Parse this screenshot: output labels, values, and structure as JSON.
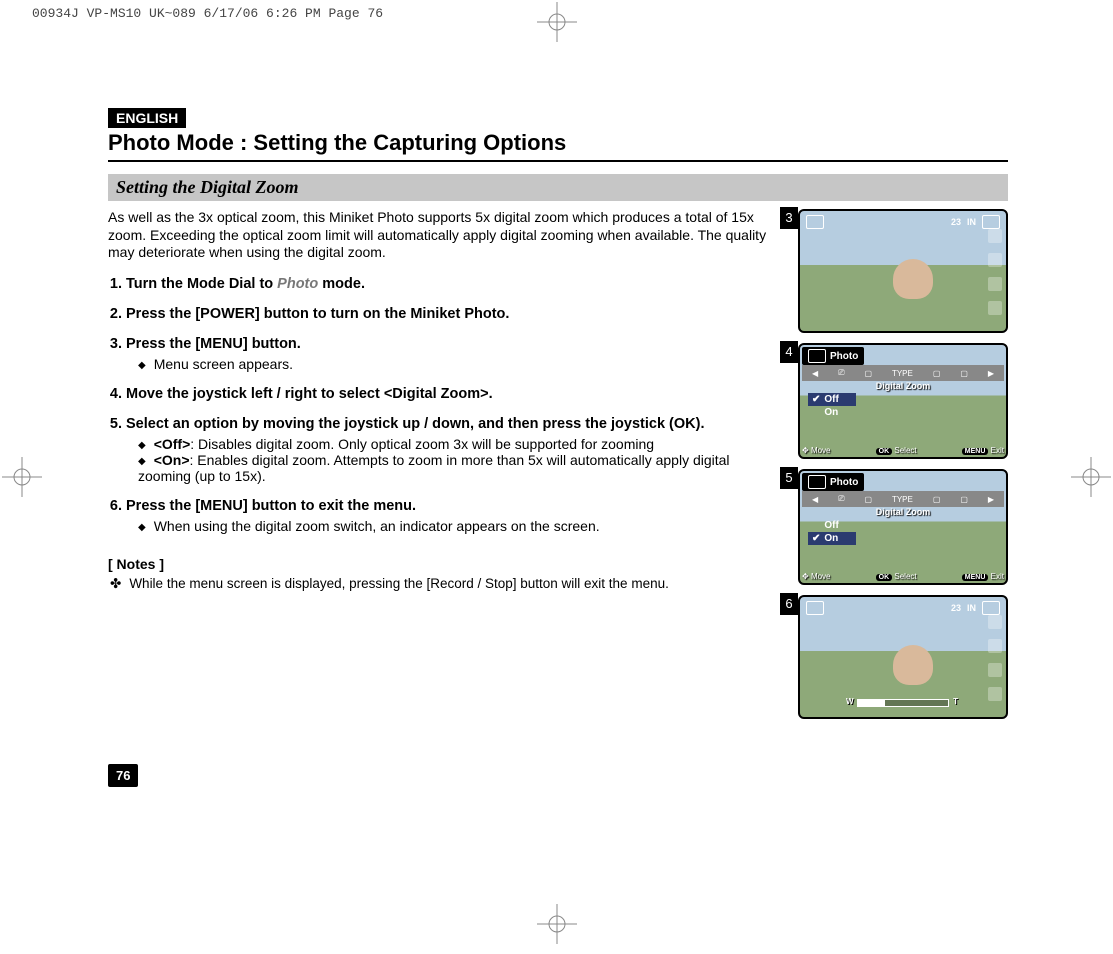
{
  "print_header": "00934J VP-MS10 UK~089  6/17/06 6:26 PM  Page 76",
  "language_tag": "ENGLISH",
  "page_title": "Photo Mode : Setting the Capturing Options",
  "section_title": "Setting the Digital Zoom",
  "intro": "As well as the 3x optical zoom, this Miniket Photo supports 5x digital zoom which produces a total of 15x zoom. Exceeding the optical zoom limit will automatically apply digital zooming when available. The quality may deteriorate when using the digital zoom.",
  "steps": {
    "s1": {
      "text_before": "Turn the Mode Dial to ",
      "em": "Photo",
      "text_after": " mode."
    },
    "s2": "Press the [POWER] button to turn on the Miniket Photo.",
    "s3": {
      "head": "Press the [MENU] button.",
      "sub1": "Menu screen appears."
    },
    "s4": "Move the joystick left / right to select <Digital Zoom>.",
    "s5": {
      "head": "Select an option by moving the joystick up / down, and then press the joystick (OK).",
      "off_label": "<Off>",
      "off_text": ": Disables digital zoom. Only optical zoom 3x will be supported for zooming",
      "on_label": "<On>",
      "on_text": ": Enables digital zoom. Attempts to zoom in more than 5x will automatically apply digital zooming (up to 15x)."
    },
    "s6": {
      "head": "Press the [MENU] button to exit the menu.",
      "sub1": "When using the digital zoom switch, an indicator appears on the screen."
    }
  },
  "notes_heading": "[ Notes ]",
  "notes": {
    "n1": "While the menu screen is displayed, pressing the [Record / Stop] button will exit the menu."
  },
  "page_number": "76",
  "figures": {
    "f3": {
      "num": "3",
      "count": "23",
      "storage": "IN"
    },
    "f4": {
      "num": "4",
      "mode": "Photo",
      "menu_title": "Digital Zoom",
      "opt_off": "Off",
      "opt_on": "On",
      "selected": "Off",
      "btn_move": "Move",
      "btn_ok": "OK",
      "btn_select": "Select",
      "btn_menu": "MENU",
      "btn_exit": "Exit"
    },
    "f5": {
      "num": "5",
      "mode": "Photo",
      "menu_title": "Digital Zoom",
      "opt_off": "Off",
      "opt_on": "On",
      "selected": "On",
      "btn_move": "Move",
      "btn_ok": "OK",
      "btn_select": "Select",
      "btn_menu": "MENU",
      "btn_exit": "Exit"
    },
    "f6": {
      "num": "6",
      "count": "23",
      "storage": "IN",
      "zoom_w": "W",
      "zoom_t": "T"
    }
  }
}
